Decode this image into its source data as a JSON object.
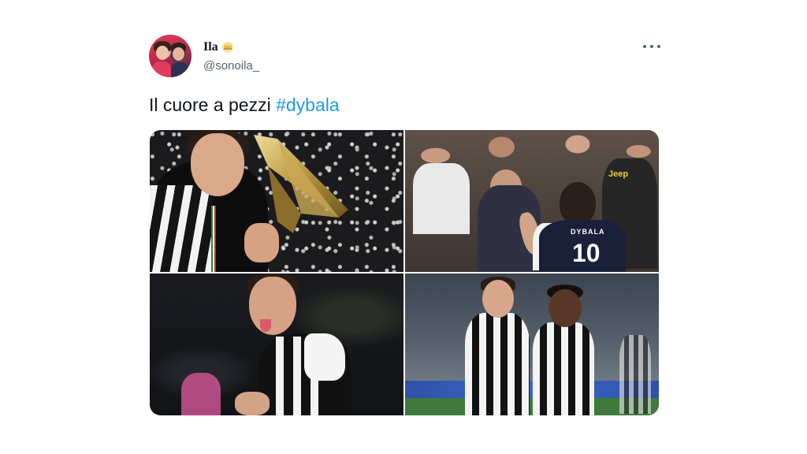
{
  "tweet": {
    "author": {
      "display_name": "Ila",
      "display_name_emoji": "crown-emoji",
      "handle": "@sonoila_"
    },
    "text_prefix": "Il cuore a pezzi ",
    "hashtag": "#dybala",
    "more_menu_icon": "more-options-icon",
    "media": [
      {
        "description_icon": "photo",
        "jersey_logo": ""
      },
      {
        "description_icon": "photo",
        "jersey_name": "DYBALA",
        "jersey_number": "10",
        "shirt_sponsor": "Jeep"
      },
      {
        "description_icon": "photo"
      },
      {
        "description_icon": "photo"
      }
    ]
  },
  "colors": {
    "text": "#0f1419",
    "secondary": "#536471",
    "link": "#1d9bf0",
    "background": "#ffffff"
  }
}
